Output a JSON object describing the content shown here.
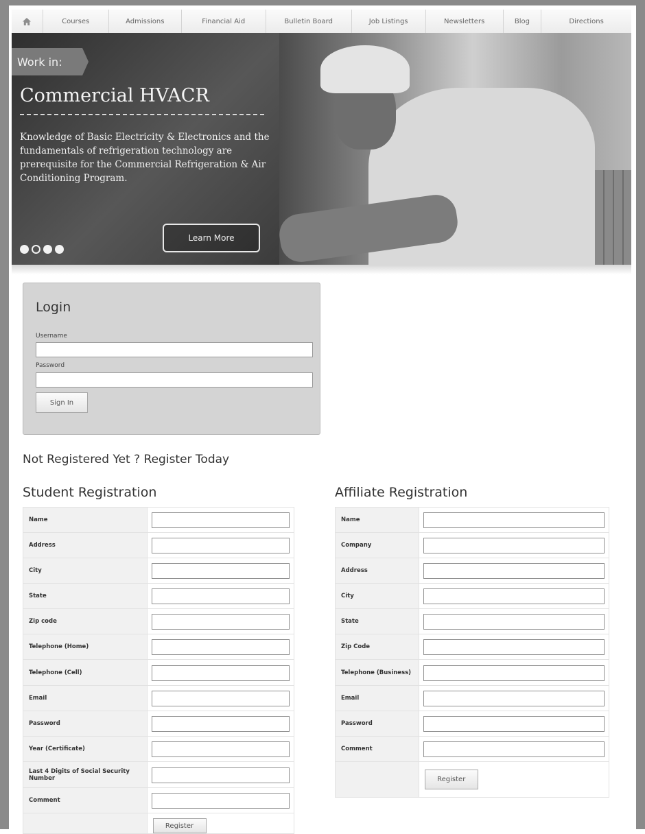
{
  "nav": {
    "home_icon": "home-icon",
    "items": [
      "Courses",
      "Admissions",
      "Financial Aid",
      "Bulletin Board",
      "Job Listings",
      "Newsletters",
      "Blog",
      "Directions"
    ]
  },
  "hero": {
    "tag": "Work in:",
    "title": "Commercial HVACR",
    "description": "Knowledge of Basic Electricity & Electronics and the fundamentals of refrigeration technology are prerequisite for the Commercial Refrigeration & Air Conditioning Program.",
    "learn_more": "Learn More",
    "slides": {
      "count": 4,
      "active_index": 0
    }
  },
  "login": {
    "title": "Login",
    "username_label": "Username",
    "username_value": "",
    "password_label": "Password",
    "password_value": "",
    "sign_in": "Sign In"
  },
  "register_heading": "Not Registered Yet ? Register Today",
  "student": {
    "title": "Student Registration",
    "fields": [
      "Name",
      "Address",
      "City",
      "State",
      "Zip code",
      "Telephone (Home)",
      "Telephone (Cell)",
      "Email",
      "Password",
      "Year (Certificate)",
      "Last 4 Digits of Social Security Number",
      "Comment"
    ],
    "register": "Register"
  },
  "affiliate": {
    "title": "Affiliate Registration",
    "fields": [
      "Name",
      "Company",
      "Address",
      "City",
      "State",
      "Zip Code",
      "Telephone (Business)",
      "Email",
      "Password",
      "Comment"
    ],
    "register": "Register"
  }
}
